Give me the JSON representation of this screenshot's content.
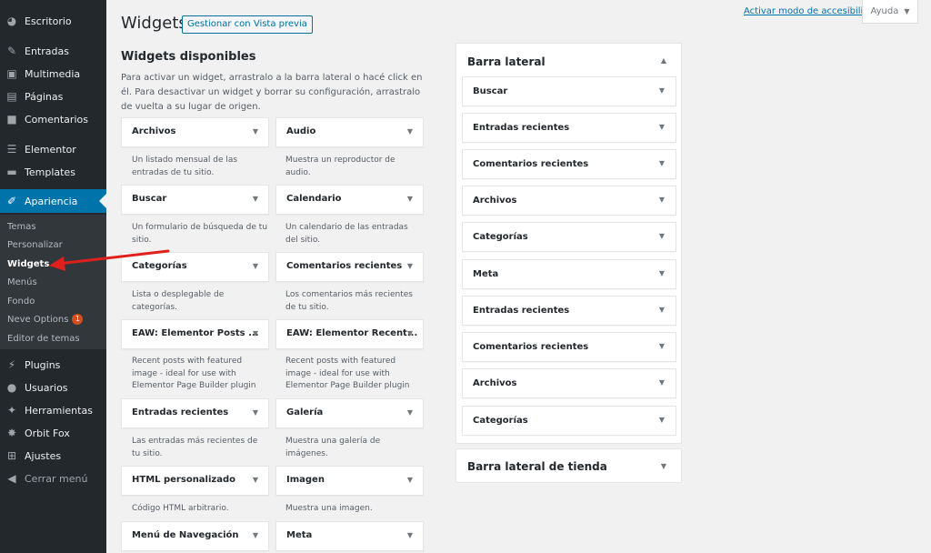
{
  "sidebar": {
    "items": [
      {
        "label": "Escritorio",
        "icon": "dashboard-icon"
      },
      {
        "label": "Entradas",
        "icon": "pin-icon"
      },
      {
        "label": "Multimedia",
        "icon": "media-icon"
      },
      {
        "label": "Páginas",
        "icon": "page-icon"
      },
      {
        "label": "Comentarios",
        "icon": "comment-icon"
      },
      {
        "label": "Elementor",
        "icon": "elementor-icon"
      },
      {
        "label": "Templates",
        "icon": "folder-icon"
      },
      {
        "label": "Apariencia",
        "icon": "brush-icon"
      },
      {
        "label": "Plugins",
        "icon": "plugin-icon"
      },
      {
        "label": "Usuarios",
        "icon": "user-icon"
      },
      {
        "label": "Herramientas",
        "icon": "wrench-icon"
      },
      {
        "label": "Orbit Fox",
        "icon": "fox-icon"
      },
      {
        "label": "Ajustes",
        "icon": "settings-icon"
      },
      {
        "label": "Cerrar menú",
        "icon": "collapse-icon"
      }
    ],
    "submenu": [
      {
        "label": "Temas"
      },
      {
        "label": "Personalizar"
      },
      {
        "label": "Widgets"
      },
      {
        "label": "Menús"
      },
      {
        "label": "Fondo"
      },
      {
        "label": "Neve Options",
        "badge": "1"
      },
      {
        "label": "Editor de temas"
      }
    ]
  },
  "header": {
    "title": "Widgets",
    "manage_button": "Gestionar con Vista previa",
    "accessibility_link": "Activar modo de accesibilidad",
    "help_button": "Ayuda"
  },
  "available": {
    "title": "Widgets disponibles",
    "description": "Para activar un widget, arrastralo a la barra lateral o hacé click en él. Para desactivar un widget y borrar su configuración, arrastralo de vuelta a su lugar de origen.",
    "widgets": [
      {
        "title": "Archivos",
        "desc": "Un listado mensual de las entradas de tu sitio."
      },
      {
        "title": "Audio",
        "desc": "Muestra un reproductor de audio."
      },
      {
        "title": "Buscar",
        "desc": "Un formulario de búsqueda de tu sitio."
      },
      {
        "title": "Calendario",
        "desc": "Un calendario de las entradas del sitio."
      },
      {
        "title": "Categorías",
        "desc": "Lista o desplegable de categorías."
      },
      {
        "title": "Comentarios recientes",
        "desc": "Los comentarios más recientes de tu sitio."
      },
      {
        "title": "EAW: Elementor Posts ...",
        "desc": "Recent posts with featured image - ideal for use with Elementor Page Builder plugin"
      },
      {
        "title": "EAW: Elementor Recent...",
        "desc": "Recent posts with featured image - ideal for use with Elementor Page Builder plugin"
      },
      {
        "title": "Entradas recientes",
        "desc": "Las entradas más recientes de tu sitio."
      },
      {
        "title": "Galería",
        "desc": "Muestra una galería de imágenes."
      },
      {
        "title": "HTML personalizado",
        "desc": "Código HTML arbitrario."
      },
      {
        "title": "Imagen",
        "desc": "Muestra una imagen."
      },
      {
        "title": "Menú de Navegación",
        "desc": ""
      },
      {
        "title": "Meta",
        "desc": ""
      }
    ]
  },
  "sidebar_areas": [
    {
      "title": "Barra lateral",
      "widgets": [
        "Buscar",
        "Entradas recientes",
        "Comentarios recientes",
        "Archivos",
        "Categorías",
        "Meta",
        "Entradas recientes",
        "Comentarios recientes",
        "Archivos",
        "Categorías"
      ]
    },
    {
      "title": "Barra lateral de tienda",
      "widgets": []
    }
  ],
  "colors": {
    "admin_menu_bg": "#23282d",
    "submenu_bg": "#32373c",
    "accent": "#0073aa",
    "badge": "#d54e21",
    "annotation_arrow": "#e0201c"
  }
}
